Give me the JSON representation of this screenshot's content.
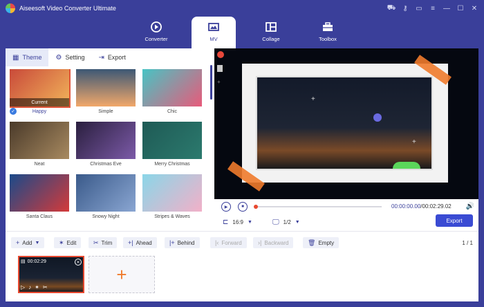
{
  "titlebar": {
    "title": "Aiseesoft Video Converter Ultimate",
    "controls": [
      "cart-icon",
      "key-icon",
      "chat-icon",
      "menu-icon",
      "minimize-icon",
      "maximize-icon",
      "close-icon"
    ]
  },
  "mainnav": {
    "items": [
      {
        "label": "Converter",
        "icon": "converter-icon",
        "active": false
      },
      {
        "label": "MV",
        "icon": "mv-icon",
        "active": true
      },
      {
        "label": "Collage",
        "icon": "collage-icon",
        "active": false
      },
      {
        "label": "Toolbox",
        "icon": "toolbox-icon",
        "active": false
      }
    ]
  },
  "tabs": [
    {
      "label": "Theme",
      "icon": "theme-icon",
      "active": true
    },
    {
      "label": "Setting",
      "icon": "gear-icon",
      "active": false
    },
    {
      "label": "Export",
      "icon": "export-icon",
      "active": false
    }
  ],
  "themes": [
    {
      "label": "Happy",
      "selected": true,
      "badge": "Current",
      "colors": [
        "#c94a3a",
        "#f2b45a"
      ]
    },
    {
      "label": "Simple",
      "selected": false,
      "colors": [
        "#3d5875",
        "#f2a86a"
      ]
    },
    {
      "label": "Chic",
      "selected": false,
      "colors": [
        "#47c4c4",
        "#e85a7a"
      ]
    },
    {
      "label": "Neat",
      "selected": false,
      "colors": [
        "#4a3a2a",
        "#a88a60"
      ]
    },
    {
      "label": "Christmas Eve",
      "selected": false,
      "colors": [
        "#2a1f3e",
        "#7c5aa8"
      ]
    },
    {
      "label": "Merry Christmas",
      "selected": false,
      "colors": [
        "#1e5a55",
        "#2c7a6e"
      ]
    },
    {
      "label": "Santa Claus",
      "selected": false,
      "colors": [
        "#1a4a8a",
        "#d43a3a"
      ]
    },
    {
      "label": "Snowy Night",
      "selected": false,
      "colors": [
        "#3a5a8a",
        "#8aa6d2"
      ]
    },
    {
      "label": "Stripes & Waves",
      "selected": false,
      "colors": [
        "#8ad6e8",
        "#f2b0c8"
      ]
    }
  ],
  "preview": {
    "current_time": "00:00:00.00",
    "total_time": "/00:02:29.02",
    "aspect_ratio": "16:9",
    "resolution_fraction": "1/2",
    "export_label": "Export"
  },
  "toolbar": {
    "add": "Add",
    "edit": "Edit",
    "trim": "Trim",
    "ahead": "Ahead",
    "behind": "Behind",
    "forward": "Forward",
    "backward": "Backward",
    "empty": "Empty",
    "pager": "1 / 1"
  },
  "timeline": {
    "clip_duration": "00:02:29"
  },
  "colors": {
    "primary": "#3a3f9a",
    "accent": "#f07b2c",
    "button": "#3a4bd3"
  }
}
